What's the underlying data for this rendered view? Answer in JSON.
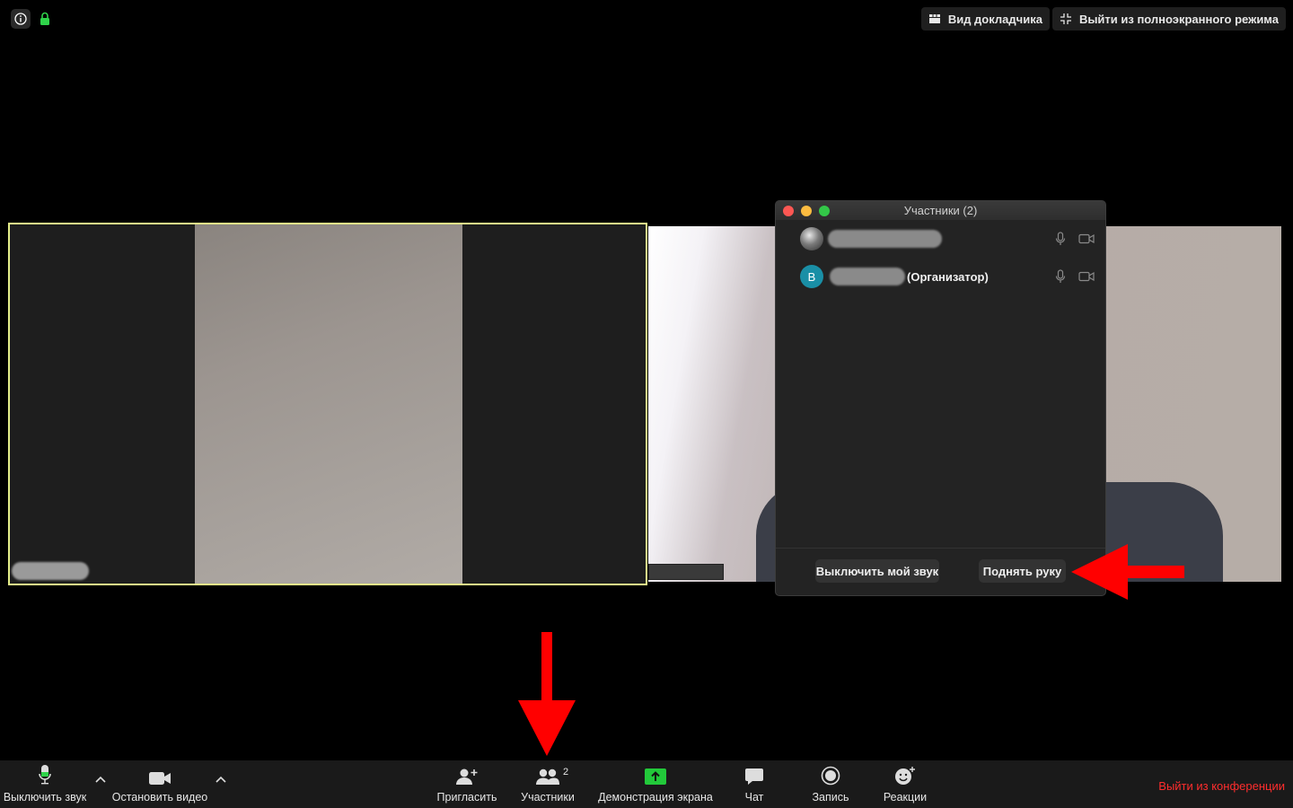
{
  "top_bar": {
    "speaker_view_label": "Вид докладчика",
    "exit_fullscreen_label": "Выйти из полноэкранного режима"
  },
  "participants_panel": {
    "title": "Участники (2)",
    "participants": [
      {
        "avatar": "photo",
        "name_suffix": ""
      },
      {
        "avatar_letter": "B",
        "name_suffix": "(Организатор)"
      }
    ],
    "mute_me_label": "Выключить мой звук",
    "raise_hand_label": "Поднять руку"
  },
  "toolbar": {
    "mute_label": "Выключить звук",
    "stop_video_label": "Остановить видео",
    "invite_label": "Пригласить",
    "participants_label": "Участники",
    "participants_count": "2",
    "share_screen_label": "Демонстрация экрана",
    "chat_label": "Чат",
    "record_label": "Запись",
    "reactions_label": "Реакции",
    "leave_label": "Выйти из конференции"
  },
  "colors": {
    "active_speaker_border": "#e6f08a",
    "annotation_arrow": "#ff0000",
    "leave_text": "#ff2d2d",
    "share_green": "#22c93a"
  }
}
